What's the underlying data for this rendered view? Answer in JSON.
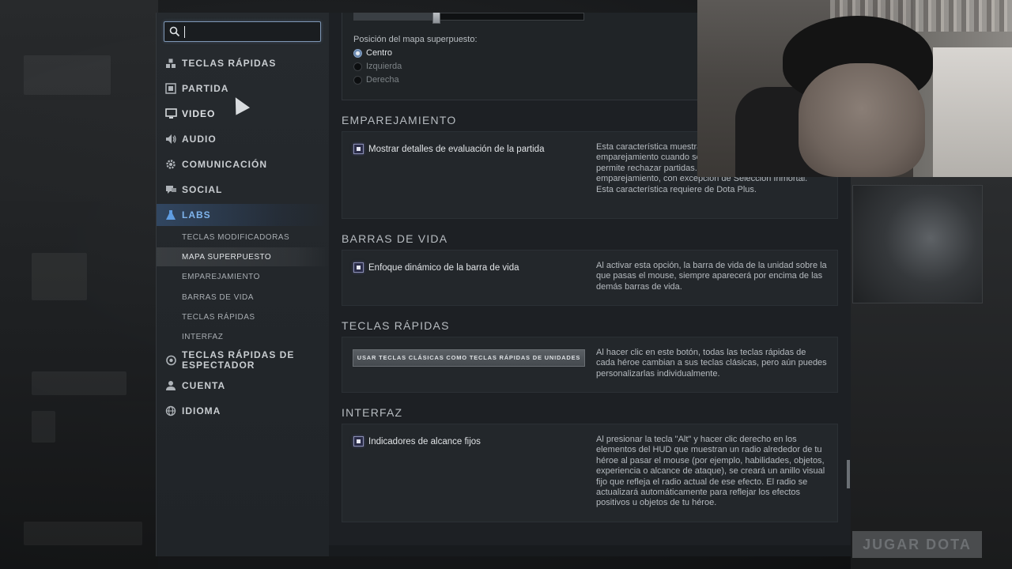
{
  "search": {
    "value": "",
    "placeholder": ""
  },
  "sidebar": {
    "items": [
      {
        "label": "TECLAS RÁPIDAS",
        "icon": "hotkeys-icon"
      },
      {
        "label": "PARTIDA",
        "icon": "game-icon"
      },
      {
        "label": "VIDEO",
        "icon": "monitor-icon"
      },
      {
        "label": "AUDIO",
        "icon": "speaker-icon"
      },
      {
        "label": "COMUNICACIÓN",
        "icon": "gear-icon"
      },
      {
        "label": "SOCIAL",
        "icon": "chat-icon"
      },
      {
        "label": "LABS",
        "icon": "flask-icon",
        "active": true
      },
      {
        "label": "TECLAS RÁPIDAS DE ESPECTADOR",
        "icon": "spectator-icon"
      },
      {
        "label": "CUENTA",
        "icon": "user-icon"
      },
      {
        "label": "IDIOMA",
        "icon": "globe-icon"
      }
    ],
    "subitems": [
      "TECLAS MODIFICADORAS",
      "MAPA SUPERPUESTO",
      "EMPAREJAMIENTO",
      "BARRAS DE VIDA",
      "TECLAS RÁPIDAS",
      "INTERFAZ"
    ],
    "selected_subitem": "MAPA SUPERPUESTO"
  },
  "overlay_map": {
    "slider_value": 0.35,
    "position_title": "Posición del mapa superpuesto:",
    "options": [
      "Centro",
      "Izquierda",
      "Derecha"
    ],
    "selected": "Centro"
  },
  "sections": {
    "matchmaking": {
      "title": "EMPAREJAMIENTO",
      "checkbox_label": "Mostrar detalles de evaluación de la partida",
      "checked": true,
      "description": "Esta característica muestra detalles de evaluación de emparejamiento cuando se encuentra una partida y te permite rechazar partidas. Aplica a todos los modos de emparejamiento, con excepción de Selección Inmortal. Esta característica requiere de Dota Plus."
    },
    "health_bars": {
      "title": "BARRAS DE VIDA",
      "checkbox_label": "Enfoque dinámico de la barra de vida",
      "checked": true,
      "description": "Al activar esta opción, la barra de vida de la unidad sobre la que pasas el mouse, siempre aparecerá por encima de las demás barras de vida."
    },
    "hotkeys": {
      "title": "TECLAS RÁPIDAS",
      "button_label": "USAR TECLAS CLÁSICAS COMO TECLAS RÁPIDAS DE UNIDADES",
      "description": "Al hacer clic en este botón, todas las teclas rápidas de cada héroe cambian a sus teclas clásicas, pero aún puedes personalizarlas individualmente."
    },
    "interface": {
      "title": "INTERFAZ",
      "checkbox_label": "Indicadores de alcance fijos",
      "checked": true,
      "description": "Al presionar la tecla \"Alt\" y hacer clic derecho en los elementos del HUD que muestran un radio alrededor de tu héroe al pasar el mouse (por ejemplo, habilidades, objetos, experiencia o alcance de ataque), se creará un anillo visual fijo que refleja el radio actual de ese efecto. El radio se actualizará automáticamente para reflejar los efectos positivos u objetos de tu héroe."
    }
  },
  "background": {
    "play_button": "JUGAR DOTA"
  },
  "colors": {
    "accent": "#7fb4ec",
    "panel": "#23272b",
    "sidebar": "#23272b"
  }
}
